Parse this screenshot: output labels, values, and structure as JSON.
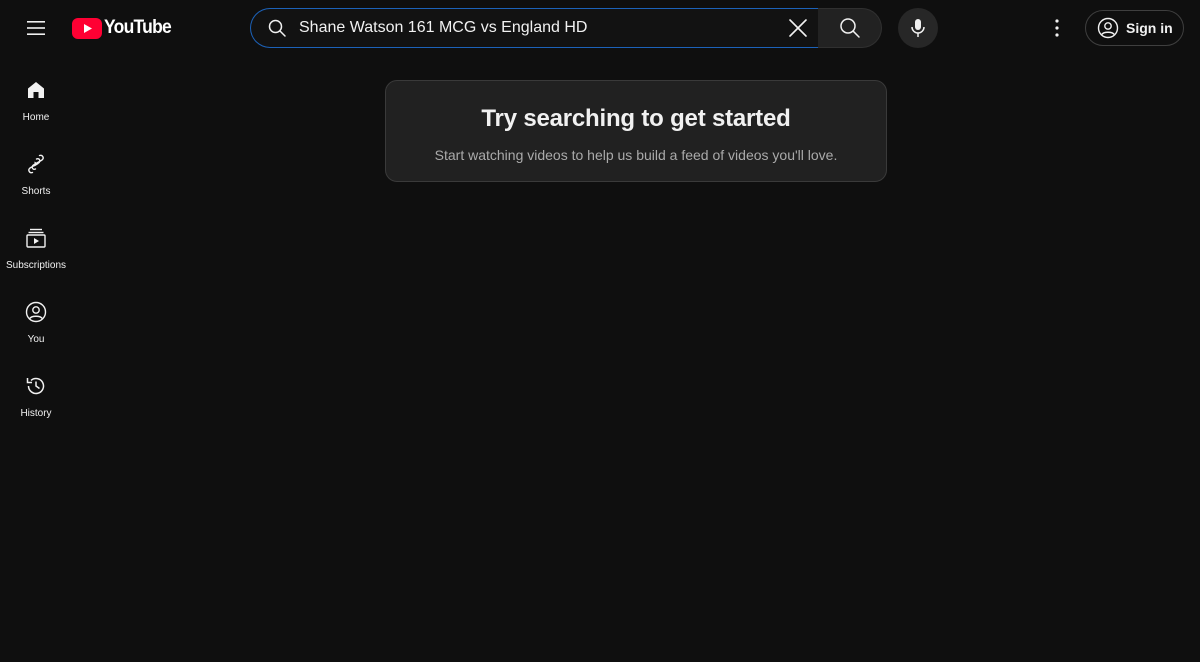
{
  "header": {
    "logo_text": "YouTube",
    "search": {
      "value": "Shane Watson 161 MCG vs England HD"
    },
    "signin_label": "Sign in"
  },
  "sidebar": {
    "items": [
      {
        "label": "Home",
        "icon": "home-icon"
      },
      {
        "label": "Shorts",
        "icon": "shorts-icon"
      },
      {
        "label": "Subscriptions",
        "icon": "subscriptions-icon"
      },
      {
        "label": "You",
        "icon": "you-icon"
      },
      {
        "label": "History",
        "icon": "history-icon"
      }
    ]
  },
  "main": {
    "title": "Try searching to get started",
    "subtitle": "Start watching videos to help us build a feed of videos you'll love."
  },
  "colors": {
    "background": "#0f0f0f",
    "brand_red": "#ff0033",
    "focus_border": "#1c62b9",
    "card_bg": "#212121"
  }
}
